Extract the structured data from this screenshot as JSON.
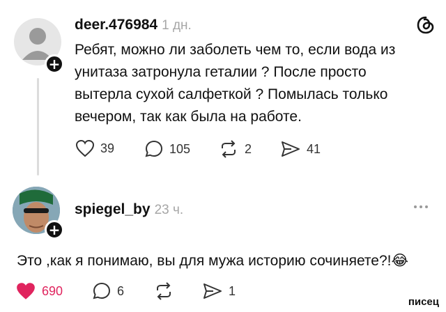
{
  "post": {
    "username": "deer.476984",
    "time": "1 дн.",
    "text": "Ребят, можно ли заболеть чем то, если вода из унитаза затронула геталии ? После просто вытерла сухой салфеткой ? Помылась только вечером, так как была на работе.",
    "actions": {
      "likes": "39",
      "comments": "105",
      "reposts": "2",
      "shares": "41"
    }
  },
  "reply": {
    "username": "spiegel_by",
    "time": "23 ч.",
    "text": "Это ,как я понимаю, вы для мужа историю сочиняете?!",
    "emoji": "😂",
    "actions": {
      "likes": "690",
      "comments": "6",
      "shares": "1"
    }
  },
  "watermark": "писец",
  "colors": {
    "like_active": "#e0245e",
    "muted": "#a6a6a6"
  },
  "icons": [
    "threads-logo-icon",
    "heart-icon",
    "comment-icon",
    "repost-icon",
    "share-icon",
    "more-icon",
    "plus-icon"
  ]
}
